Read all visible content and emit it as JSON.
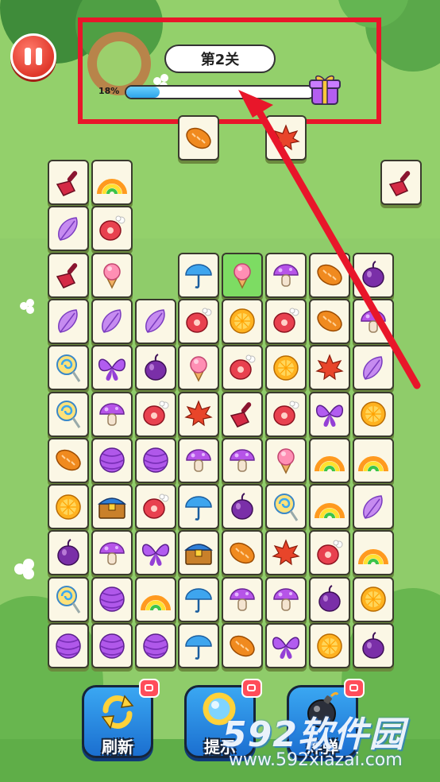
{
  "hud": {
    "level_label": "第2关",
    "progress_text": "18%",
    "progress_value": 0.18
  },
  "board": {
    "tiles": [
      {
        "icon": "bread-icon",
        "row": -1,
        "col": 3
      },
      {
        "icon": "maple-leaf-icon",
        "row": -1,
        "col": 5
      },
      {
        "icon": "shovel-icon",
        "row": 0,
        "col": 0
      },
      {
        "icon": "rainbow-icon",
        "row": 0,
        "col": 1
      },
      {
        "icon": "shovel-icon",
        "row": 0,
        "col": 7.65
      },
      {
        "icon": "feather-icon",
        "row": 1,
        "col": 0
      },
      {
        "icon": "meat-icon",
        "row": 1,
        "col": 1
      },
      {
        "icon": "shovel-icon",
        "row": 2,
        "col": 0
      },
      {
        "icon": "ice-cream-icon",
        "row": 2,
        "col": 1
      },
      {
        "icon": "umbrella-icon",
        "row": 2,
        "col": 3
      },
      {
        "icon": "ice-cream-icon",
        "row": 2,
        "col": 4,
        "selected": true
      },
      {
        "icon": "mushroom-icon",
        "row": 2,
        "col": 5
      },
      {
        "icon": "bread-icon",
        "row": 2,
        "col": 6
      },
      {
        "icon": "onion-icon",
        "row": 2,
        "col": 7
      },
      {
        "icon": "feather-icon",
        "row": 3,
        "col": 0
      },
      {
        "icon": "feather-icon",
        "row": 3,
        "col": 1
      },
      {
        "icon": "feather-icon",
        "row": 3,
        "col": 2
      },
      {
        "icon": "meat-icon",
        "row": 3,
        "col": 3
      },
      {
        "icon": "orange-icon",
        "row": 3,
        "col": 4
      },
      {
        "icon": "meat-icon",
        "row": 3,
        "col": 5
      },
      {
        "icon": "bread-icon",
        "row": 3,
        "col": 6
      },
      {
        "icon": "mushroom-icon",
        "row": 3,
        "col": 7
      },
      {
        "icon": "lollipop-icon",
        "row": 4,
        "col": 0
      },
      {
        "icon": "butterfly-icon",
        "row": 4,
        "col": 1
      },
      {
        "icon": "onion-icon",
        "row": 4,
        "col": 2
      },
      {
        "icon": "ice-cream-icon",
        "row": 4,
        "col": 3
      },
      {
        "icon": "meat-icon",
        "row": 4,
        "col": 4
      },
      {
        "icon": "orange-icon",
        "row": 4,
        "col": 5
      },
      {
        "icon": "maple-leaf-icon",
        "row": 4,
        "col": 6
      },
      {
        "icon": "feather-icon",
        "row": 4,
        "col": 7
      },
      {
        "icon": "lollipop-icon",
        "row": 5,
        "col": 0
      },
      {
        "icon": "mushroom-icon",
        "row": 5,
        "col": 1
      },
      {
        "icon": "meat-icon",
        "row": 5,
        "col": 2
      },
      {
        "icon": "maple-leaf-icon",
        "row": 5,
        "col": 3
      },
      {
        "icon": "shovel-icon",
        "row": 5,
        "col": 4
      },
      {
        "icon": "meat-icon",
        "row": 5,
        "col": 5
      },
      {
        "icon": "butterfly-icon",
        "row": 5,
        "col": 6
      },
      {
        "icon": "orange-icon",
        "row": 5,
        "col": 7
      },
      {
        "icon": "bread-icon",
        "row": 6,
        "col": 0
      },
      {
        "icon": "yarn-ball-icon",
        "row": 6,
        "col": 1
      },
      {
        "icon": "yarn-ball-icon",
        "row": 6,
        "col": 2
      },
      {
        "icon": "mushroom-icon",
        "row": 6,
        "col": 3
      },
      {
        "icon": "mushroom-icon",
        "row": 6,
        "col": 4
      },
      {
        "icon": "ice-cream-icon",
        "row": 6,
        "col": 5
      },
      {
        "icon": "rainbow-icon",
        "row": 6,
        "col": 6
      },
      {
        "icon": "rainbow-icon",
        "row": 6,
        "col": 7
      },
      {
        "icon": "orange-icon",
        "row": 7,
        "col": 0
      },
      {
        "icon": "treasure-chest-icon",
        "row": 7,
        "col": 1
      },
      {
        "icon": "meat-icon",
        "row": 7,
        "col": 2
      },
      {
        "icon": "umbrella-icon",
        "row": 7,
        "col": 3
      },
      {
        "icon": "onion-icon",
        "row": 7,
        "col": 4
      },
      {
        "icon": "lollipop-icon",
        "row": 7,
        "col": 5
      },
      {
        "icon": "rainbow-icon",
        "row": 7,
        "col": 6
      },
      {
        "icon": "feather-icon",
        "row": 7,
        "col": 7
      },
      {
        "icon": "onion-icon",
        "row": 8,
        "col": 0
      },
      {
        "icon": "mushroom-icon",
        "row": 8,
        "col": 1
      },
      {
        "icon": "butterfly-icon",
        "row": 8,
        "col": 2
      },
      {
        "icon": "treasure-chest-icon",
        "row": 8,
        "col": 3
      },
      {
        "icon": "bread-icon",
        "row": 8,
        "col": 4
      },
      {
        "icon": "maple-leaf-icon",
        "row": 8,
        "col": 5
      },
      {
        "icon": "meat-icon",
        "row": 8,
        "col": 6
      },
      {
        "icon": "rainbow-icon",
        "row": 8,
        "col": 7
      },
      {
        "icon": "lollipop-icon",
        "row": 9,
        "col": 0
      },
      {
        "icon": "yarn-ball-icon",
        "row": 9,
        "col": 1
      },
      {
        "icon": "rainbow-icon",
        "row": 9,
        "col": 2
      },
      {
        "icon": "umbrella-icon",
        "row": 9,
        "col": 3
      },
      {
        "icon": "mushroom-icon",
        "row": 9,
        "col": 4
      },
      {
        "icon": "mushroom-icon",
        "row": 9,
        "col": 5
      },
      {
        "icon": "onion-icon",
        "row": 9,
        "col": 6
      },
      {
        "icon": "orange-icon",
        "row": 9,
        "col": 7
      },
      {
        "icon": "yarn-ball-icon",
        "row": 10,
        "col": 0
      },
      {
        "icon": "yarn-ball-icon",
        "row": 10,
        "col": 1
      },
      {
        "icon": "yarn-ball-icon",
        "row": 10,
        "col": 2
      },
      {
        "icon": "umbrella-icon",
        "row": 10,
        "col": 3
      },
      {
        "icon": "bread-icon",
        "row": 10,
        "col": 4
      },
      {
        "icon": "butterfly-icon",
        "row": 10,
        "col": 5
      },
      {
        "icon": "orange-icon",
        "row": 10,
        "col": 6
      },
      {
        "icon": "onion-icon",
        "row": 10,
        "col": 7
      }
    ]
  },
  "powerups": {
    "refresh_label": "刷新",
    "hint_label": "提示",
    "bomb_label": "炸弹"
  },
  "watermark": {
    "brand": "592软件园",
    "url": "www.592xiazai.com"
  },
  "colors": {
    "highlight_frame": "#e8162a",
    "selected_tile": "#7ddc63",
    "tile_face": "#fbf7e5",
    "background": "#8fcc6a"
  }
}
